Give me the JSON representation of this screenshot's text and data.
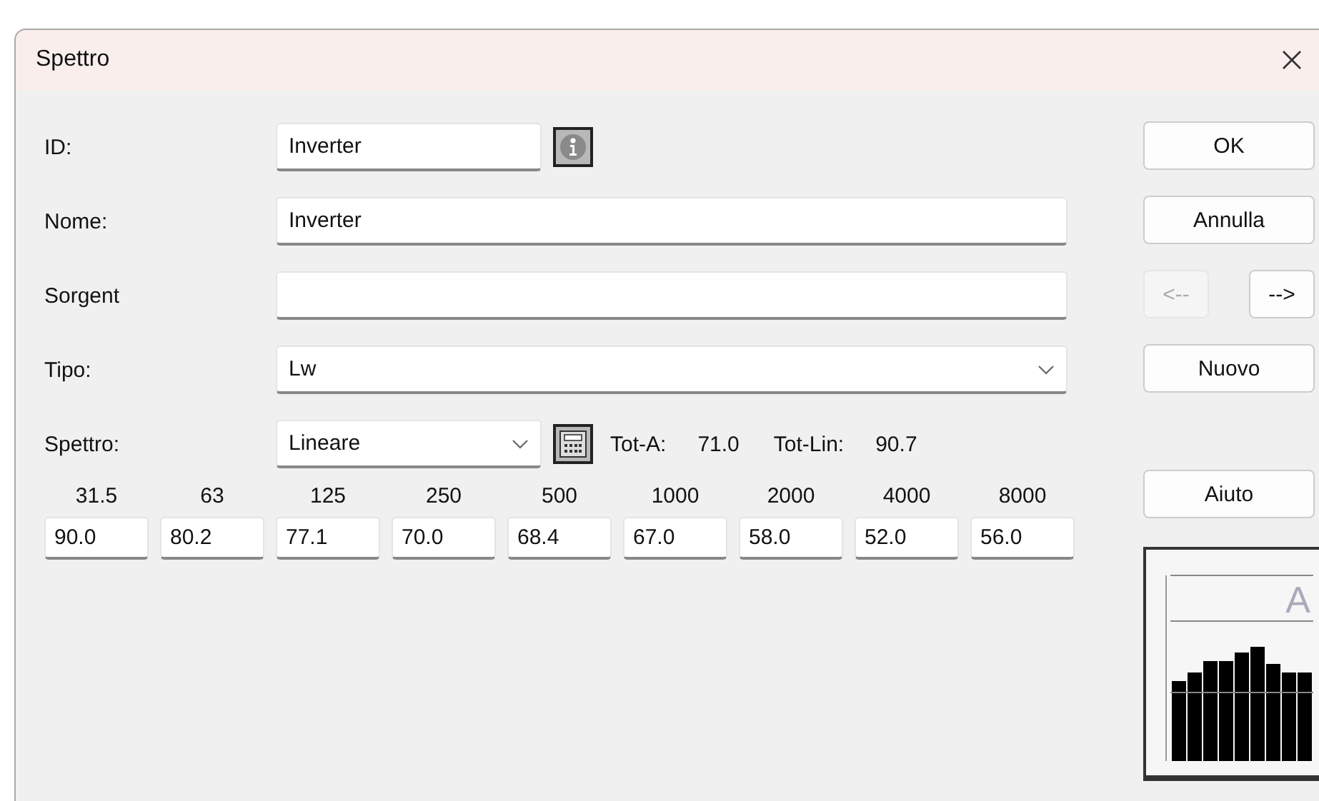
{
  "window": {
    "title": "Spettro"
  },
  "fields": [
    {
      "kind": "text",
      "label": "ID:",
      "value": "Inverter",
      "info_button": true
    },
    {
      "kind": "text",
      "label": "Nome:",
      "value": "Inverter"
    },
    {
      "kind": "text",
      "label": "Sorgent"
    },
    {
      "kind": "dropdown",
      "label": "Tipo:",
      "value": "Lw"
    },
    {
      "kind": "spectrum",
      "label": "Spettro:",
      "value": "Lineare"
    }
  ],
  "totals": [
    {
      "label": "Tot-A:",
      "value": "71.0"
    },
    {
      "label": "Tot-Lin:",
      "value": "90.7"
    }
  ],
  "bands": [
    {
      "freq": "31.5",
      "value": "90.0"
    },
    {
      "freq": "63",
      "value": "80.2"
    },
    {
      "freq": "125",
      "value": "77.1"
    },
    {
      "freq": "250",
      "value": "70.0"
    },
    {
      "freq": "500",
      "value": "68.4"
    },
    {
      "freq": "1000",
      "value": "67.0"
    },
    {
      "freq": "2000",
      "value": "58.0"
    },
    {
      "freq": "4000",
      "value": "52.0"
    },
    {
      "freq": "8000",
      "value": "56.0"
    }
  ],
  "buttons": [
    {
      "kind": "wide",
      "label": "OK",
      "disabled": false
    },
    {
      "kind": "wide",
      "label": "Annulla",
      "disabled": false
    },
    {
      "kind": "half",
      "label": "<--",
      "disabled": true
    },
    {
      "kind": "half",
      "label": "-->",
      "disabled": false
    },
    {
      "kind": "wide",
      "label": "Nuovo",
      "disabled": false
    },
    {
      "kind": "gap"
    },
    {
      "kind": "wide",
      "label": "Aiuto",
      "disabled": false
    }
  ],
  "preview": {
    "letter": "A"
  }
}
